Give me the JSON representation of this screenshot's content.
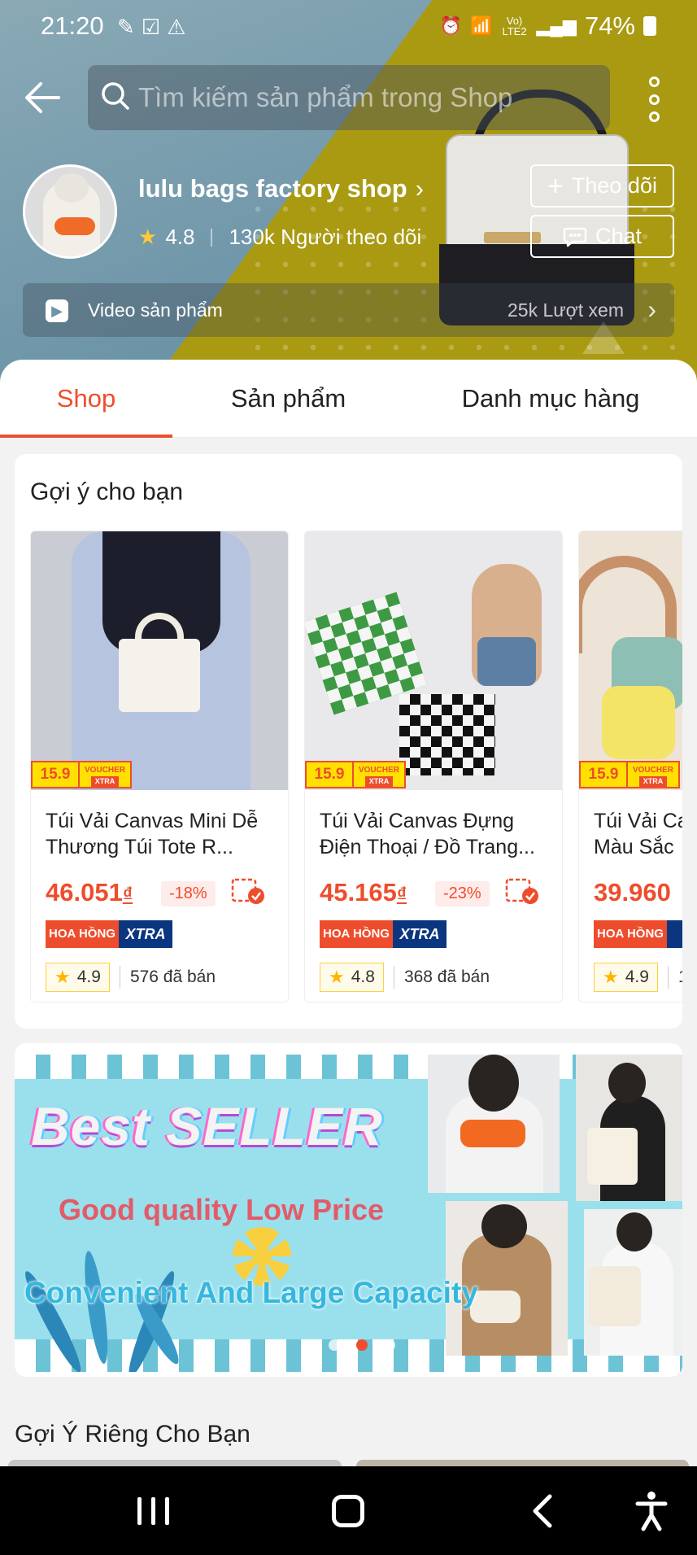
{
  "status_bar": {
    "time": "21:20",
    "network": "Vo) LTE2",
    "battery": "74%"
  },
  "search": {
    "placeholder": "Tìm kiếm sản phẩm trong Shop"
  },
  "shop": {
    "name": "lulu bags factory shop",
    "rating": "4.8",
    "followers": "130k Người theo dõi",
    "follow_label": "Theo dõi",
    "chat_label": "Chat",
    "video_label": "Video sản phẩm",
    "video_views": "25k Lượt xem"
  },
  "tabs": [
    {
      "label": "Shop",
      "active": true
    },
    {
      "label": "Sản phẩm",
      "active": false
    },
    {
      "label": "Danh mục hàng",
      "active": false
    }
  ],
  "recommended": {
    "title": "Gợi ý cho bạn",
    "products": [
      {
        "badge": "15.9",
        "badge_voucher": "VOUCHER",
        "badge_xtra": "XTRA",
        "name": "Túi Vải Canvas Mini Dễ Thương Túi Tote R...",
        "price": "46.051",
        "currency": "₫",
        "discount": "-18%",
        "commission_label": "HOA HỒNG",
        "xtra_label": "XTRA",
        "rating": "4.9",
        "sold": "576 đã bán"
      },
      {
        "badge": "15.9",
        "badge_voucher": "VOUCHER",
        "badge_xtra": "XTRA",
        "name": "Túi Vải Canvas Đựng Điện Thoại / Đồ Trang...",
        "price": "45.165",
        "currency": "₫",
        "discount": "-23%",
        "commission_label": "HOA HỒNG",
        "xtra_label": "XTRA",
        "rating": "4.8",
        "sold": "368 đã bán"
      },
      {
        "badge": "15.9",
        "badge_voucher": "VOUCHER",
        "badge_xtra": "XTRA",
        "name": "Túi Vải Ca Màu Sắc",
        "price": "39.960",
        "currency": "",
        "discount": "",
        "commission_label": "HOA HỒNG",
        "xtra_label": "",
        "rating": "4.9",
        "sold": "1"
      }
    ]
  },
  "banner": {
    "headline": "Best SELLER",
    "line2": "Good quality Low Price",
    "line3": "Convenient And Large Capacity",
    "active_dot": 3,
    "dot_count": 4
  },
  "personal": {
    "title": "Gợi Ý Riêng Cho Bạn"
  },
  "colors": {
    "accent": "#ee4d2d",
    "xtra_blue": "#0a3680",
    "rating_star": "#ffc83d"
  }
}
